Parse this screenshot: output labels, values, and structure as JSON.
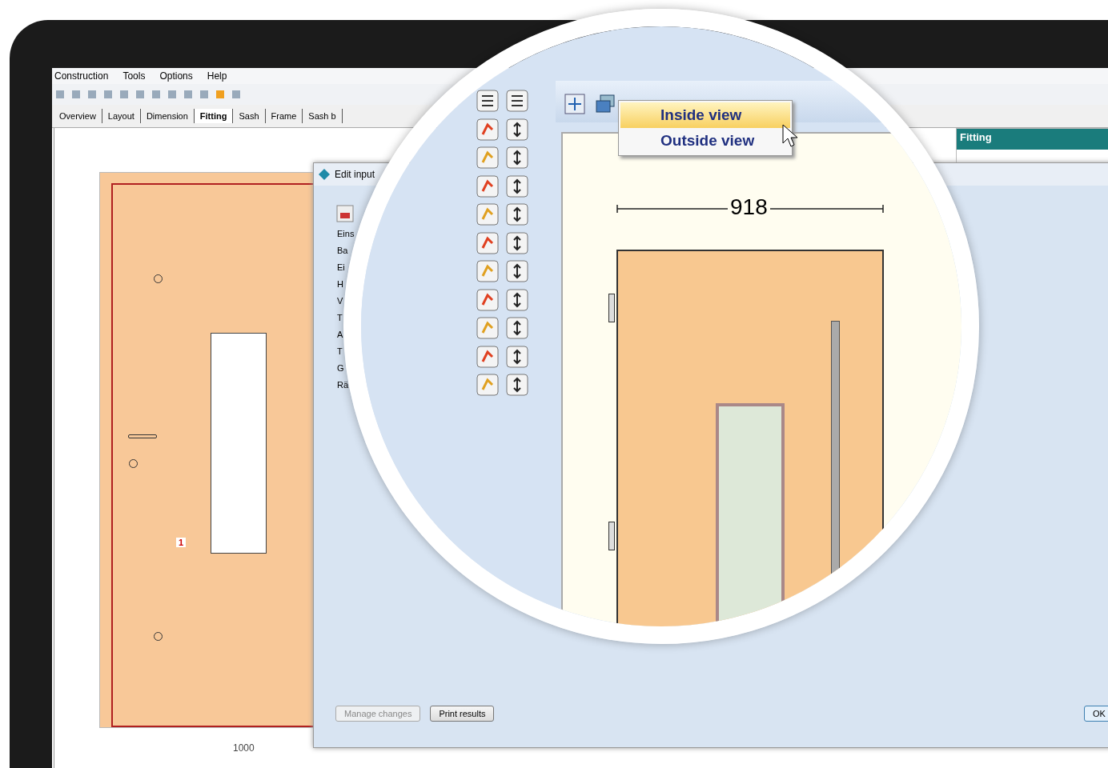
{
  "menu_bar": [
    "Construction",
    "Tools",
    "Options",
    "Help"
  ],
  "tabs": [
    {
      "label": "Overview",
      "selected": false
    },
    {
      "label": "Layout",
      "selected": false
    },
    {
      "label": "Dimension",
      "selected": false
    },
    {
      "label": "Fitting",
      "selected": true
    },
    {
      "label": "Sash",
      "selected": false
    },
    {
      "label": "Frame",
      "selected": false
    },
    {
      "label": "Sash b",
      "selected": false
    }
  ],
  "drawing": {
    "marker": "1",
    "width_label": "1000"
  },
  "dialog": {
    "title": "Edit input",
    "field_labels": [
      "Eins",
      "Ba",
      "Ei",
      "H",
      "V",
      "T",
      "A",
      "T",
      "G",
      "Rä"
    ],
    "buttons": [
      {
        "label": "Manage changes",
        "disabled": true
      },
      {
        "label": "Print results",
        "disabled": false
      }
    ],
    "ok": "OK"
  },
  "side_panel": {
    "title": "Fitting"
  },
  "magnifier": {
    "dimension": "918",
    "context_menu": [
      {
        "label": "Inside view",
        "selected": true
      },
      {
        "label": "Outside view",
        "selected": false
      }
    ]
  }
}
